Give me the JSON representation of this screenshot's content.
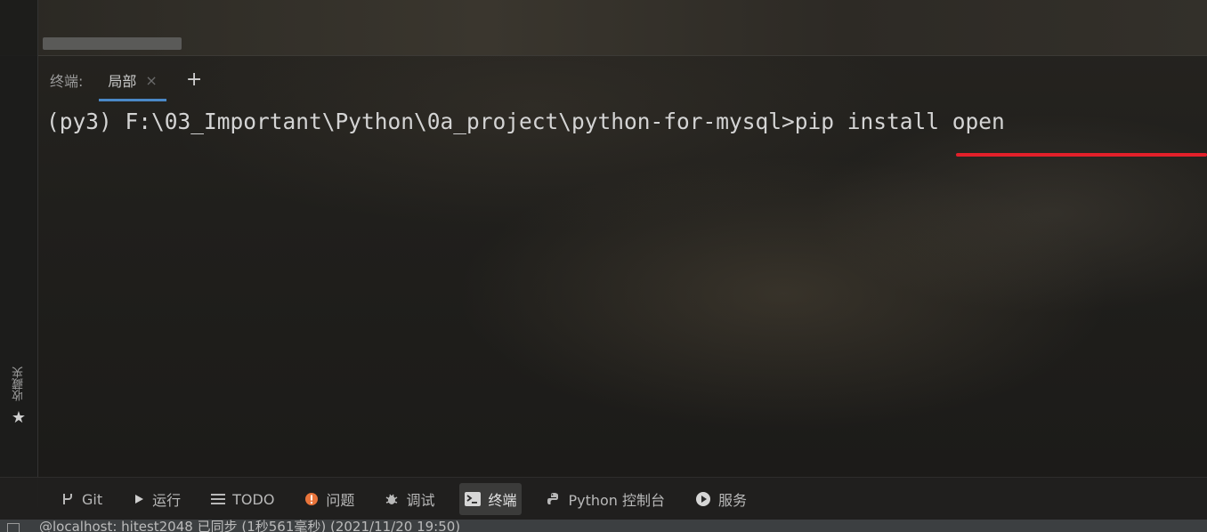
{
  "sidebar": {
    "favorites_label": "收藏夹"
  },
  "terminal": {
    "title": "终端:",
    "tab_label": "局部",
    "close_glyph": "×",
    "new_tab_glyph": "+",
    "line": "(py3) F:\\03_Important\\Python\\0a_project\\python-for-mysql>pip install open"
  },
  "toolbar": {
    "items": [
      {
        "label": "Git",
        "icon": "git-branch-icon"
      },
      {
        "label": "运行",
        "icon": "run-icon"
      },
      {
        "label": "TODO",
        "icon": "todo-list-icon"
      },
      {
        "label": "问题",
        "icon": "problems-icon"
      },
      {
        "label": "调试",
        "icon": "debug-bug-icon"
      },
      {
        "label": "终端",
        "icon": "terminal-icon",
        "active": true
      },
      {
        "label": "Python 控制台",
        "icon": "python-icon"
      },
      {
        "label": "服务",
        "icon": "services-icon"
      }
    ]
  },
  "status": {
    "text": "@localhost: hitest2048 已同步 (1秒561毫秒) (2021/11/20 19:50)"
  },
  "colors": {
    "accent": "#4a88c7",
    "annotation_red": "#e3202a",
    "problems_orange": "#e8743b"
  }
}
